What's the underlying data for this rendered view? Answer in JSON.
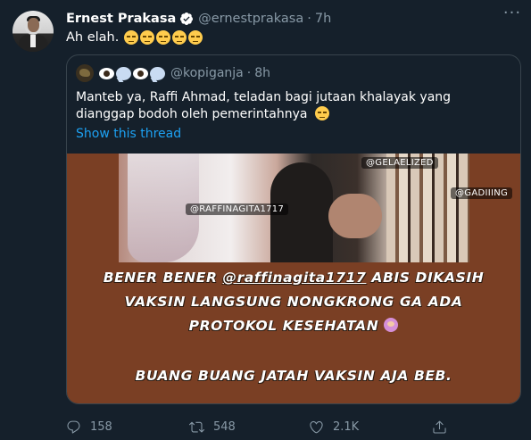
{
  "author": {
    "name": "Ernest Prakasa",
    "handle": "@ernestprakasa",
    "time": "7h",
    "separator": "·",
    "verified": true
  },
  "tweet": {
    "text": "Ah elah.",
    "emoji": [
      "pensive-face",
      "pensive-face",
      "pensive-face",
      "pensive-face",
      "pensive-face"
    ]
  },
  "quoted": {
    "handle": "@kopiganja",
    "separator": "·",
    "time": "8h",
    "name_emoji": [
      "eyes-icon",
      "speech-bubble-icon",
      "eyes-icon",
      "speech-bubble-icon"
    ],
    "text": "Manteb ya, Raffi Ahmad, teladan bagi jutaan khalayak yang dianggap bodoh oleh pemerintahnya",
    "trailing_emoji": "pensive-face",
    "thread_link": "Show this thread",
    "media": {
      "tags": [
        "@RAFFINAGITA1717",
        "@GELAELIZED",
        "@GADIIING"
      ],
      "line1_prefix": "BENER BENER ",
      "line1_handle": "@raffinagita1717",
      "line1_suffix": " ABIS DIKASIH",
      "line2": "VAKSIN LANGSUNG NONGKRONG GA ADA",
      "line3": "PROTOKOL KESEHATAN",
      "line3_emoji": "person-shrugging",
      "line4": "BUANG BUANG JATAH VAKSIN AJA BEB."
    }
  },
  "actions": {
    "replies": "158",
    "retweets": "548",
    "likes": "2.1K",
    "more_glyph": "···"
  },
  "colors": {
    "background": "#15202b",
    "secondary_text": "#8899a6",
    "link": "#1da1f2",
    "border": "#38444d"
  }
}
